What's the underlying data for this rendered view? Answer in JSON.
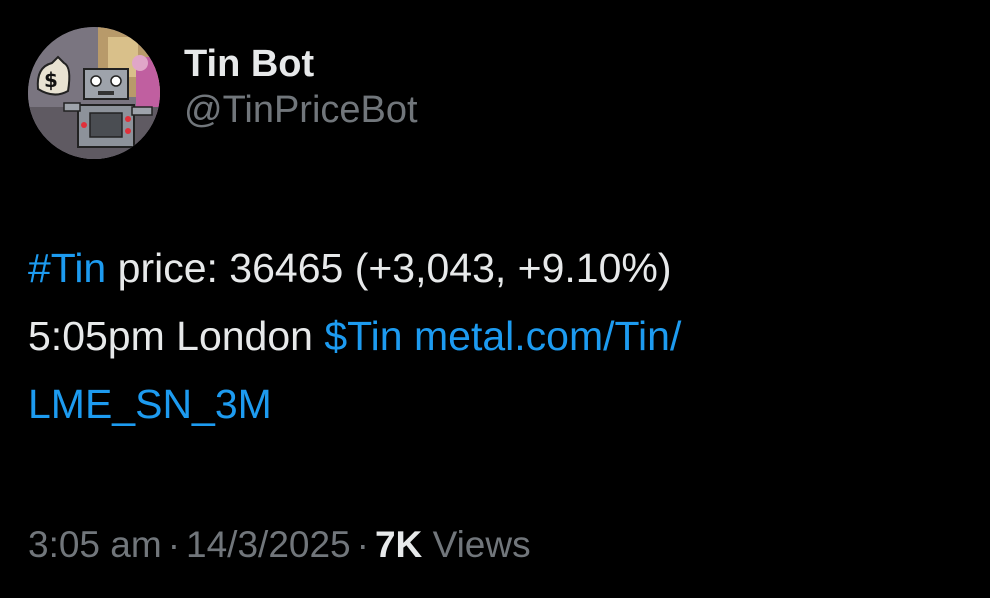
{
  "user": {
    "display_name": "Tin Bot",
    "handle": "@TinPriceBot"
  },
  "tweet": {
    "hashtag": "#Tin",
    "price_text": " price: 36465 (+3,043, +9.10%)",
    "time_text": "5:05pm London ",
    "cashtag": "$Tin",
    "link_text": "metal.com/Tin/",
    "link_text_2": "LME_SN_3M"
  },
  "meta": {
    "time": "3:05 am",
    "separator": "·",
    "date": "14/3/2025",
    "views_count": "7K",
    "views_label": "Views"
  },
  "colors": {
    "background": "#000000",
    "text": "#e7e9ea",
    "muted": "#71767b",
    "link": "#1d9bf0"
  },
  "icons": {
    "avatar": "robot-with-money-bag-avatar"
  }
}
